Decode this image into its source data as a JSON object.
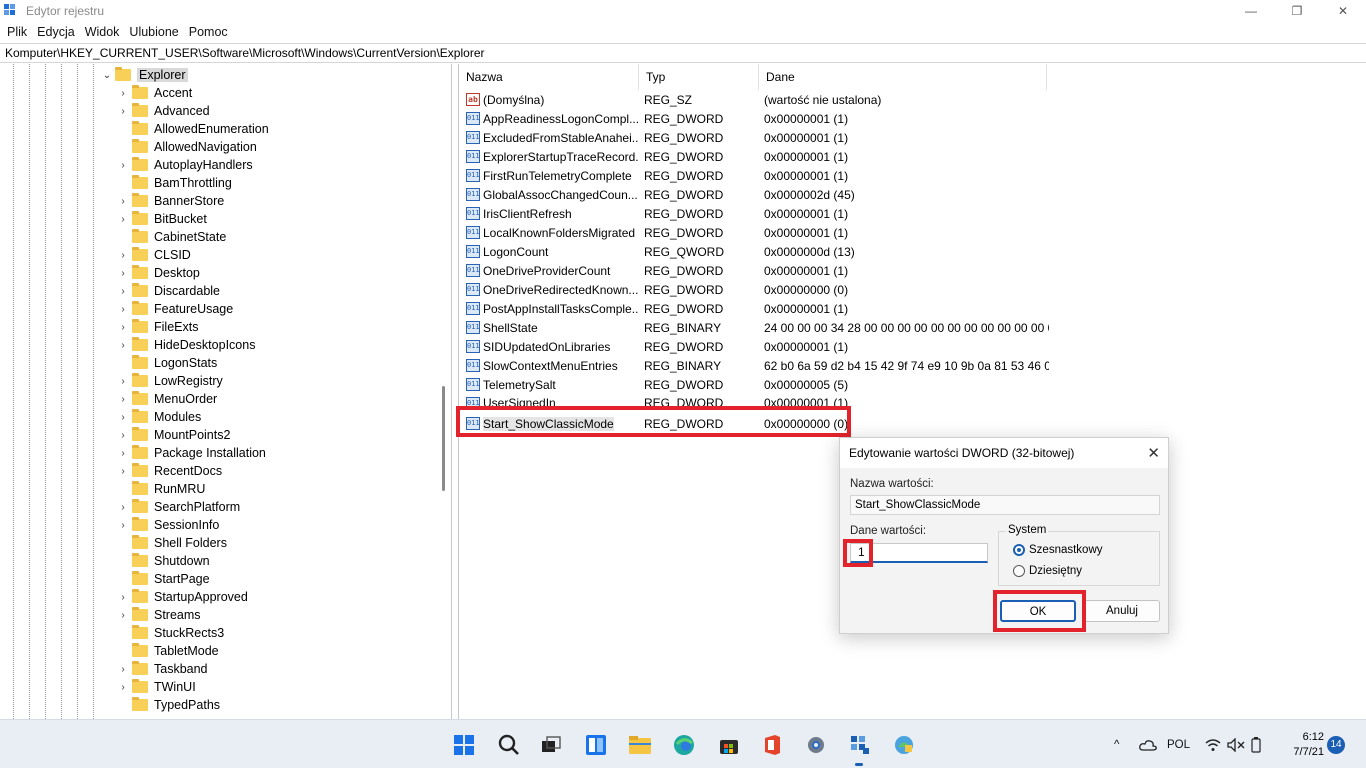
{
  "window": {
    "title": "Edytor rejestru",
    "minimize_glyph": "—",
    "restore_glyph": "❐",
    "close_glyph": "✕"
  },
  "menu": [
    "Plik",
    "Edycja",
    "Widok",
    "Ulubione",
    "Pomoc"
  ],
  "address": "Komputer\\HKEY_CURRENT_USER\\Software\\Microsoft\\Windows\\CurrentVersion\\Explorer",
  "tree": {
    "selected": "Explorer",
    "children": [
      {
        "label": "Accent",
        "expandable": true
      },
      {
        "label": "Advanced",
        "expandable": true
      },
      {
        "label": "AllowedEnumeration",
        "expandable": false
      },
      {
        "label": "AllowedNavigation",
        "expandable": false
      },
      {
        "label": "AutoplayHandlers",
        "expandable": true
      },
      {
        "label": "BamThrottling",
        "expandable": false
      },
      {
        "label": "BannerStore",
        "expandable": true
      },
      {
        "label": "BitBucket",
        "expandable": true
      },
      {
        "label": "CabinetState",
        "expandable": false
      },
      {
        "label": "CLSID",
        "expandable": true
      },
      {
        "label": "Desktop",
        "expandable": true
      },
      {
        "label": "Discardable",
        "expandable": true
      },
      {
        "label": "FeatureUsage",
        "expandable": true
      },
      {
        "label": "FileExts",
        "expandable": true
      },
      {
        "label": "HideDesktopIcons",
        "expandable": true
      },
      {
        "label": "LogonStats",
        "expandable": false
      },
      {
        "label": "LowRegistry",
        "expandable": true
      },
      {
        "label": "MenuOrder",
        "expandable": true
      },
      {
        "label": "Modules",
        "expandable": true
      },
      {
        "label": "MountPoints2",
        "expandable": true
      },
      {
        "label": "Package Installation",
        "expandable": true
      },
      {
        "label": "RecentDocs",
        "expandable": true
      },
      {
        "label": "RunMRU",
        "expandable": false
      },
      {
        "label": "SearchPlatform",
        "expandable": true
      },
      {
        "label": "SessionInfo",
        "expandable": true
      },
      {
        "label": "Shell Folders",
        "expandable": false
      },
      {
        "label": "Shutdown",
        "expandable": false
      },
      {
        "label": "StartPage",
        "expandable": false
      },
      {
        "label": "StartupApproved",
        "expandable": true
      },
      {
        "label": "Streams",
        "expandable": true
      },
      {
        "label": "StuckRects3",
        "expandable": false
      },
      {
        "label": "TabletMode",
        "expandable": false
      },
      {
        "label": "Taskband",
        "expandable": true
      },
      {
        "label": "TWinUI",
        "expandable": true
      },
      {
        "label": "TypedPaths",
        "expandable": false
      }
    ]
  },
  "list": {
    "columns": [
      "Nazwa",
      "Typ",
      "Dane"
    ],
    "rows": [
      {
        "name": "(Domyślna)",
        "type": "REG_SZ",
        "data": "(wartość nie ustalona)",
        "icon": "string-value-icon"
      },
      {
        "name": "AppReadinessLogonCompl...",
        "type": "REG_DWORD",
        "data": "0x00000001 (1)",
        "icon": "binary-value-icon"
      },
      {
        "name": "ExcludedFromStableAnahei...",
        "type": "REG_DWORD",
        "data": "0x00000001 (1)",
        "icon": "binary-value-icon"
      },
      {
        "name": "ExplorerStartupTraceRecord...",
        "type": "REG_DWORD",
        "data": "0x00000001 (1)",
        "icon": "binary-value-icon"
      },
      {
        "name": "FirstRunTelemetryComplete",
        "type": "REG_DWORD",
        "data": "0x00000001 (1)",
        "icon": "binary-value-icon"
      },
      {
        "name": "GlobalAssocChangedCoun...",
        "type": "REG_DWORD",
        "data": "0x0000002d (45)",
        "icon": "binary-value-icon"
      },
      {
        "name": "IrisClientRefresh",
        "type": "REG_DWORD",
        "data": "0x00000001 (1)",
        "icon": "binary-value-icon"
      },
      {
        "name": "LocalKnownFoldersMigrated",
        "type": "REG_DWORD",
        "data": "0x00000001 (1)",
        "icon": "binary-value-icon"
      },
      {
        "name": "LogonCount",
        "type": "REG_QWORD",
        "data": "0x0000000d (13)",
        "icon": "binary-value-icon"
      },
      {
        "name": "OneDriveProviderCount",
        "type": "REG_DWORD",
        "data": "0x00000001 (1)",
        "icon": "binary-value-icon"
      },
      {
        "name": "OneDriveRedirectedKnown...",
        "type": "REG_DWORD",
        "data": "0x00000000 (0)",
        "icon": "binary-value-icon"
      },
      {
        "name": "PostAppInstallTasksComple...",
        "type": "REG_DWORD",
        "data": "0x00000001 (1)",
        "icon": "binary-value-icon"
      },
      {
        "name": "ShellState",
        "type": "REG_BINARY",
        "data": "24 00 00 00 34 28 00 00 00 00 00 00 00 00 00 00 00 00...",
        "icon": "binary-value-icon"
      },
      {
        "name": "SIDUpdatedOnLibraries",
        "type": "REG_DWORD",
        "data": "0x00000001 (1)",
        "icon": "binary-value-icon"
      },
      {
        "name": "SlowContextMenuEntries",
        "type": "REG_BINARY",
        "data": "62 b0 6a 59 d2 b4 15 42 9f 74 e9 10 9b 0a 81 53 46 0...",
        "icon": "binary-value-icon"
      },
      {
        "name": "TelemetrySalt",
        "type": "REG_DWORD",
        "data": "0x00000005 (5)",
        "icon": "binary-value-icon"
      },
      {
        "name": "UserSignedIn",
        "type": "REG_DWORD",
        "data": "0x00000001 (1)",
        "icon": "binary-value-icon"
      },
      {
        "name": "Start_ShowClassicMode",
        "type": "REG_DWORD",
        "data": "0x00000000 (0)",
        "icon": "binary-value-icon",
        "selected": true
      }
    ]
  },
  "dialog": {
    "title": "Edytowanie wartości DWORD (32-bitowej)",
    "close_glyph": "✕",
    "value_name_label": "Nazwa wartości:",
    "value_name": "Start_ShowClassicMode",
    "value_data_label": "Dane wartości:",
    "value_data": "1",
    "base_label": "System",
    "base_options": [
      "Szesnastkowy",
      "Dziesiętny"
    ],
    "base_selected": "Szesnastkowy",
    "ok_label": "OK",
    "cancel_label": "Anuluj"
  },
  "taskbar": {
    "apps": [
      "start-icon",
      "search-icon",
      "task-view-icon",
      "widgets-icon",
      "file-explorer-icon",
      "edge-icon",
      "store-icon",
      "office-icon",
      "settings-icon",
      "registry-editor-icon",
      "control-panel-icon"
    ],
    "tray": {
      "chevron": "^",
      "language": "POL",
      "time": "6:12",
      "date": "7/7/21",
      "notifications": "14"
    }
  }
}
